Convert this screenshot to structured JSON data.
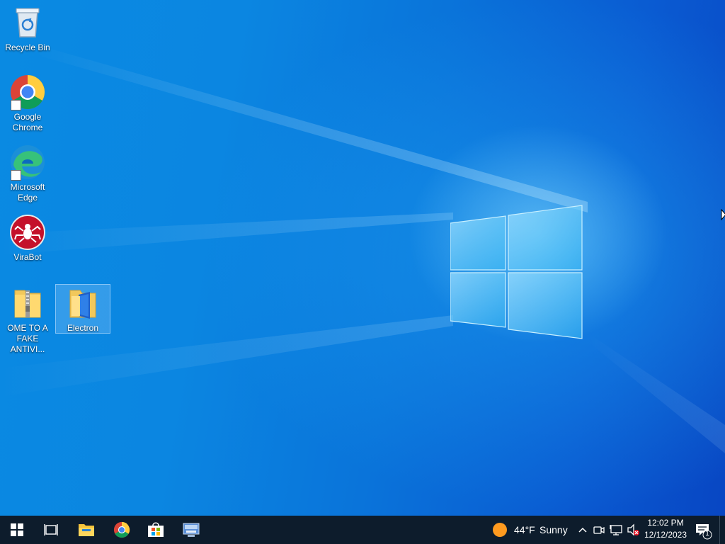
{
  "desktop": {
    "icons": [
      {
        "label": "Recycle Bin",
        "icon": "recycle-bin-icon"
      },
      {
        "label": "Google Chrome",
        "icon": "chrome-icon"
      },
      {
        "label": "Microsoft Edge",
        "icon": "edge-icon"
      },
      {
        "label": "ViraBot",
        "icon": "virabot-icon"
      },
      {
        "label": "OME TO A FAKE ANTIVI...",
        "icon": "zip-folder-icon"
      },
      {
        "label": "Electron",
        "icon": "folder-icon"
      }
    ],
    "selected_icon": "Electron"
  },
  "taskbar": {
    "buttons": [
      "start-icon",
      "task-view-icon",
      "file-explorer-icon",
      "chrome-icon",
      "microsoft-store-icon",
      "control-panel-icon"
    ],
    "weather": {
      "temperature": "44°F",
      "condition": "Sunny",
      "icon": "sun-icon"
    },
    "tray": {
      "chevron": "^",
      "icons": [
        "meet-now-icon",
        "network-icon",
        "volume-muted-icon"
      ]
    },
    "clock": {
      "time": "12:02 PM",
      "date": "12/12/2023"
    },
    "notifications": {
      "count": "1"
    }
  },
  "colors": {
    "taskbar": "#0d1c2c",
    "desktop_light": "#1ea6f0",
    "desktop_dark": "#0846c3",
    "sun": "#ff9a1f"
  }
}
